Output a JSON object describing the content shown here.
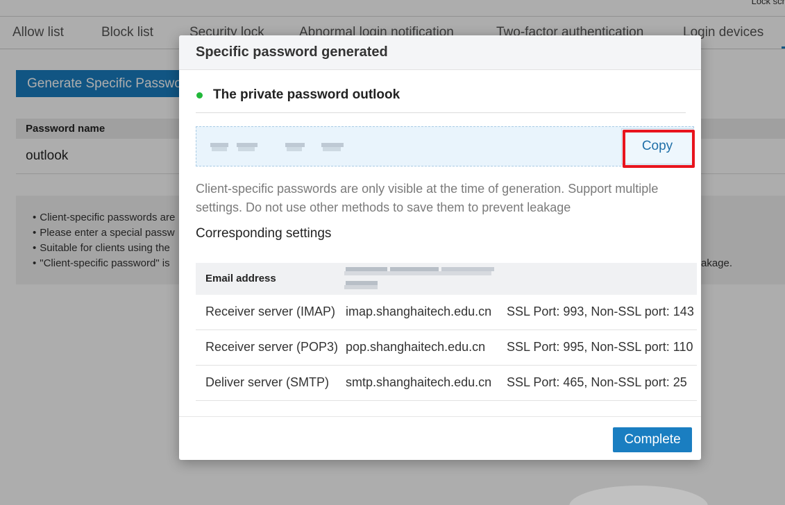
{
  "top_right": {
    "label": "Lock scr"
  },
  "tabs": [
    {
      "label": "Allow list"
    },
    {
      "label": "Block list"
    },
    {
      "label": "Security lock"
    },
    {
      "label": "Abnormal login notification"
    },
    {
      "label": "Two-factor authentication"
    },
    {
      "label": "Login devices"
    }
  ],
  "generate_button": {
    "label": "Generate Specific Password"
  },
  "password_table": {
    "header": "Password name",
    "rows": [
      {
        "name": "outlook"
      }
    ]
  },
  "notes": {
    "items": [
      "Client-specific passwords are",
      "Please enter a special passw",
      "Suitable for clients using the",
      "\"Client-specific password\" is"
    ],
    "tail": "akage."
  },
  "modal": {
    "title": "Specific password generated",
    "password_title": "The private password outlook",
    "copy_label": "Copy",
    "description": "Client-specific passwords are only visible at the time of generation. Support multiple settings. Do not use other methods to save them to prevent leakage",
    "settings_title": "Corresponding settings",
    "settings": {
      "header_label": "Email address",
      "rows": [
        {
          "label": "Receiver server (IMAP)",
          "host": "imap.shanghaitech.edu.cn",
          "ports": "SSL Port: 993, Non-SSL port: 143"
        },
        {
          "label": "Receiver server (POP3)",
          "host": "pop.shanghaitech.edu.cn",
          "ports": "SSL Port: 995, Non-SSL port: 110"
        },
        {
          "label": "Deliver server (SMTP)",
          "host": "smtp.shanghaitech.edu.cn",
          "ports": "SSL Port: 465, Non-SSL port: 25"
        }
      ]
    },
    "complete_label": "Complete"
  },
  "colors": {
    "accent": "#1a7ec1",
    "status_dot": "#21b83a",
    "highlight": "#e8141d"
  }
}
